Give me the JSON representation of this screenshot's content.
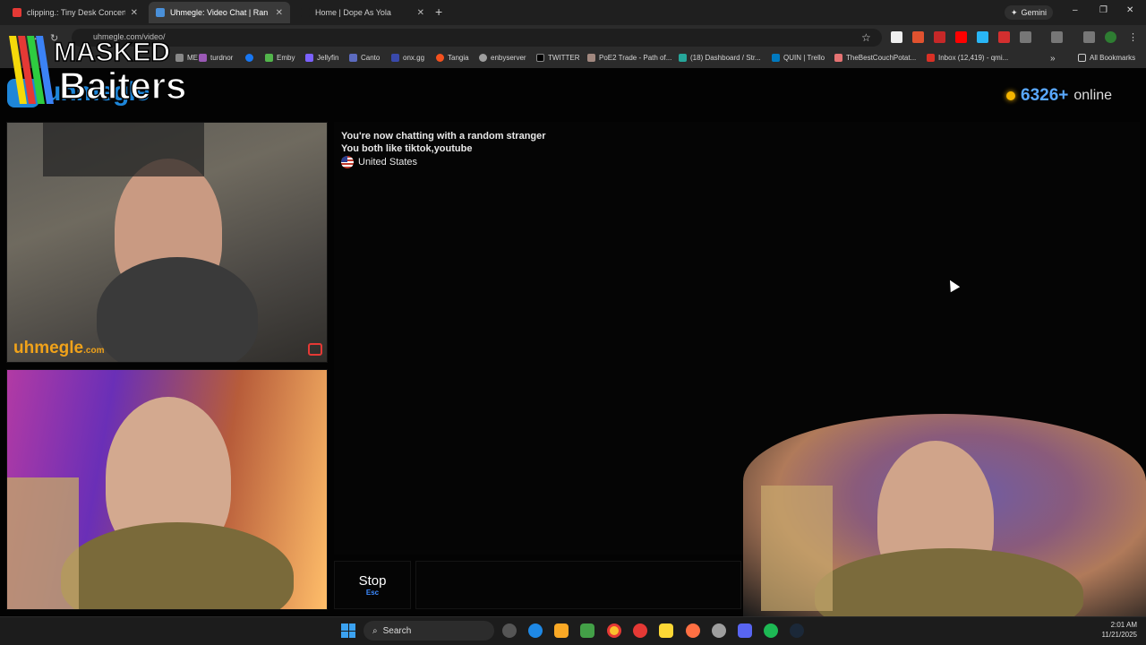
{
  "browser": {
    "tabs": [
      {
        "title": "clipping.: Tiny Desk Concert - Yo",
        "active": false,
        "favicon_color": "#e53935"
      },
      {
        "title": "Uhmegle: Video Chat | Ran",
        "active": true,
        "favicon_color": "#4a90d9"
      },
      {
        "title": "Home | Dope As Yola",
        "active": false,
        "favicon_color": "#444444"
      }
    ],
    "new_tab_label": "+",
    "gemini_label": "Gemini",
    "url": "uhmegle.com/video/",
    "window_buttons": [
      "–",
      "❐",
      "✕"
    ],
    "bookmarks": [
      {
        "label": "ME",
        "icon_color": "#888888"
      },
      {
        "label": "turdnor",
        "icon_color": "#9b59b6"
      },
      {
        "label": "",
        "icon_color": "#1877f2"
      },
      {
        "label": "Emby",
        "icon_color": "#52b54b"
      },
      {
        "label": "Jellyfin",
        "icon_color": "#7b61ff"
      },
      {
        "label": "Canto",
        "icon_color": "#5c6bc0"
      },
      {
        "label": "onx.gg",
        "icon_color": "#3949ab"
      },
      {
        "label": "Tangia",
        "icon_color": "#f4511e"
      },
      {
        "label": "enbyserver",
        "icon_color": "#9e9e9e"
      },
      {
        "label": "TWITTER",
        "icon_color": "#000000"
      },
      {
        "label": "PoE2 Trade - Path of...",
        "icon_color": "#a1887f"
      },
      {
        "label": "(18) Dashboard / Str...",
        "icon_color": "#26a69a"
      },
      {
        "label": "QUIN | Trello",
        "icon_color": "#0079bf"
      },
      {
        "label": "TheBestCouchPotat...",
        "icon_color": "#e57373"
      },
      {
        "label": "Inbox (12,419) - qmi...",
        "icon_color": "#d93025"
      }
    ],
    "bookmarks_overflow": "»",
    "all_bookmarks_label": "All Bookmarks"
  },
  "page": {
    "logo_text": "uhmegle",
    "overlay_logo_line1": "MASKED",
    "overlay_logo_line2": "Baiters",
    "online_count": "6326+",
    "online_label": "online",
    "video_watermark": "uhmegle",
    "video_watermark_suffix": ".com",
    "chat_lines": [
      "You're now chatting with a random stranger",
      "You both like tiktok,youtube"
    ],
    "country": "United States",
    "stop_label": "Stop",
    "stop_shortcut": "Esc"
  },
  "taskbar": {
    "search_label": "Search",
    "time": "2:01 AM",
    "date": "11/21/2025",
    "pinned_icons": [
      "task-view-icon",
      "edge-icon",
      "file-explorer-icon",
      "app-green-icon",
      "chrome-icon",
      "app-red-icon",
      "sticky-notes-icon",
      "firefox-icon",
      "app-gray-icon",
      "discord-icon",
      "spotify-icon",
      "steam-icon"
    ]
  },
  "colors": {
    "accent": "#1e86d9",
    "online_number": "#59a8ff",
    "shortcut": "#3d8bff",
    "watermark": "#f0a21a"
  }
}
